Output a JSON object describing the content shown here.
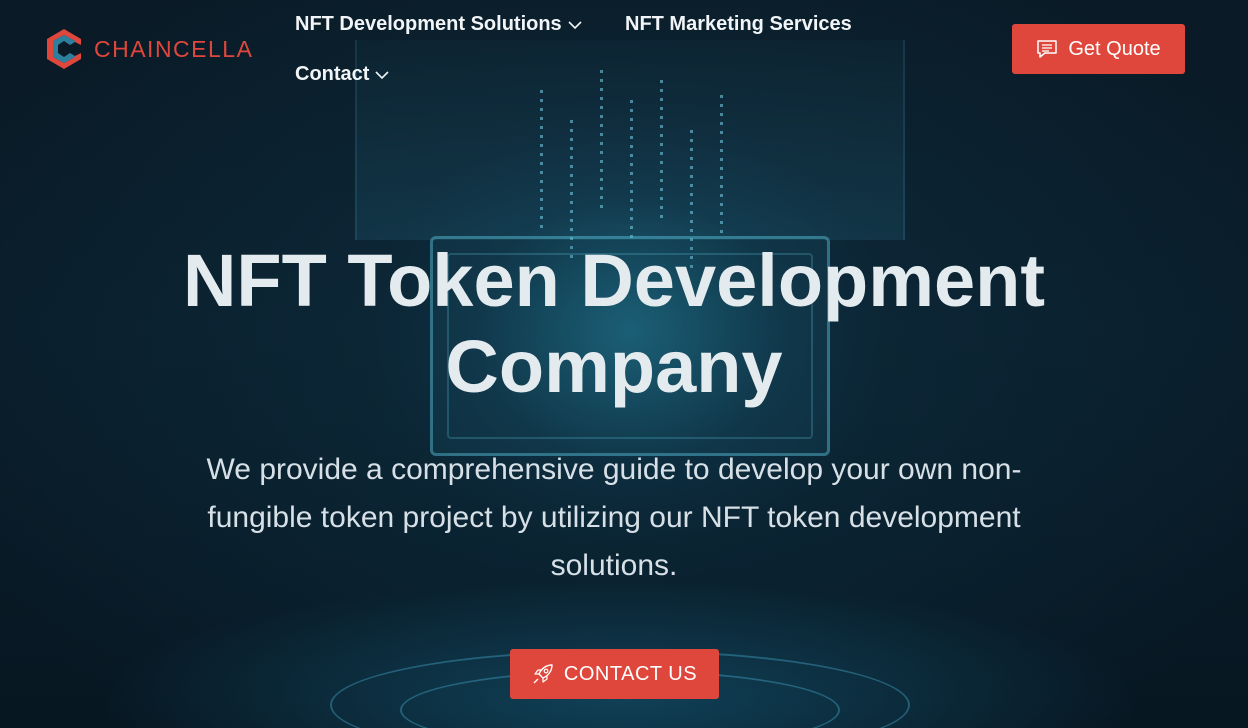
{
  "brand": {
    "name": "CHAINCELLA",
    "color": "#e0473c",
    "secondary_color": "#2d7f9e"
  },
  "nav": {
    "items": [
      {
        "label": "NFT Development Solutions",
        "has_dropdown": true
      },
      {
        "label": "NFT Marketing Services",
        "has_dropdown": false
      },
      {
        "label": "Contact",
        "has_dropdown": true
      }
    ]
  },
  "header": {
    "cta_label": "Get Quote",
    "cta_icon": "chat-message-icon"
  },
  "hero": {
    "title": "NFT Token Development Company",
    "subtitle": "We provide a comprehensive guide to develop your own non-fungible token project by utilizing our NFT token development solutions.",
    "cta_label": "CONTACT US",
    "cta_icon": "rocket-icon",
    "background_theme": "dark teal circuit / NFT chip"
  },
  "colors": {
    "accent": "#e0473c",
    "background": "#0a1a26",
    "text": "#e4ebef"
  }
}
